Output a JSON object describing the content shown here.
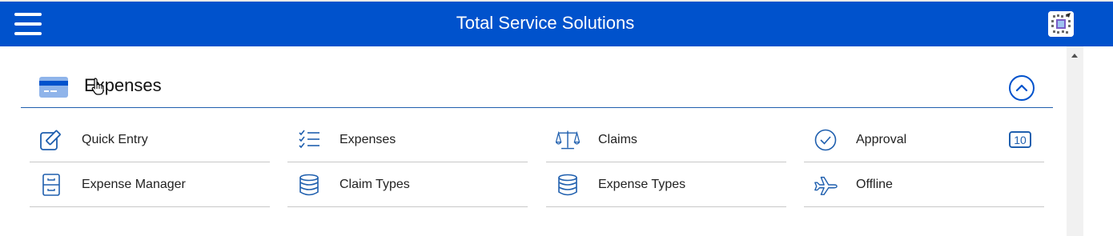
{
  "header": {
    "title": "Total Service Solutions",
    "menu_icon": "hamburger-menu-icon",
    "logo_icon": "app-logo-icon"
  },
  "colors": {
    "primary": "#0052cc",
    "accent": "#1f5fae",
    "divider": "#c8c8c8",
    "scrollbar": "#f1f1f1"
  },
  "section": {
    "title": "Expenses",
    "icon": "credit-card-icon",
    "collapse_icon": "chevron-up-circle-icon"
  },
  "menu": {
    "items": [
      {
        "label": "Quick Entry",
        "icon": "edit-icon"
      },
      {
        "label": "Expenses",
        "icon": "checklist-icon"
      },
      {
        "label": "Claims",
        "icon": "scales-icon"
      },
      {
        "label": "Approval",
        "icon": "check-circle-icon",
        "badge": "10"
      },
      {
        "label": "Expense Manager",
        "icon": "filing-cabinet-icon"
      },
      {
        "label": "Claim Types",
        "icon": "database-icon"
      },
      {
        "label": "Expense Types",
        "icon": "database-icon"
      },
      {
        "label": "Offline",
        "icon": "airplane-icon"
      }
    ]
  }
}
